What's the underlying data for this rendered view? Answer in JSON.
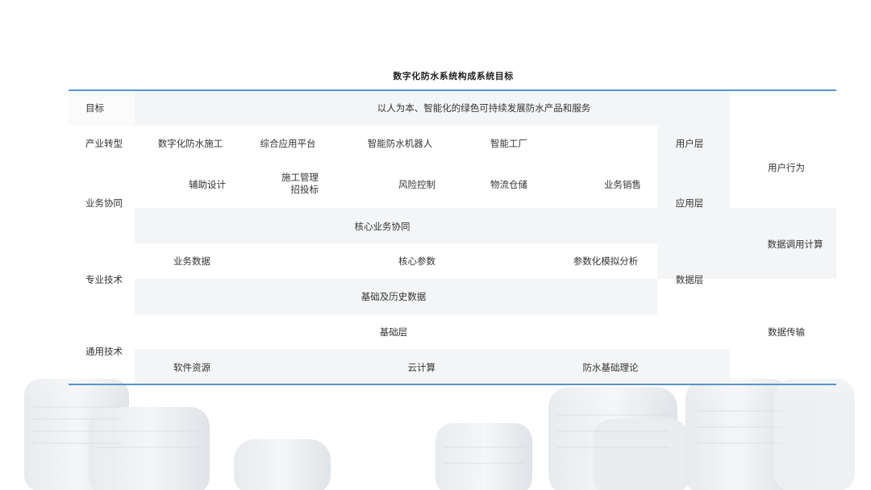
{
  "title": "数字化防水系统构成系统目标",
  "rows": {
    "goal": {
      "label": "目标",
      "text": "以人为本、智能化的绿色可持续发展防水产品和服务"
    },
    "transform": {
      "label": "产业转型",
      "items": [
        "数字化防水施工",
        "综合应用平台",
        "智能防水机器人",
        "智能工厂"
      ],
      "layer": "用户层"
    },
    "business": {
      "label": "业务协同",
      "items": [
        "辅助设计",
        "风险控制",
        "物流仓储",
        "业务销售"
      ],
      "stack": [
        "施工管理",
        "招投标"
      ],
      "core": "核心业务协同",
      "layer": "应用层"
    },
    "pro": {
      "label": "专业技术",
      "items": [
        "业务数据",
        "核心参数",
        "参数化模拟分析"
      ],
      "base": "基础及历史数据",
      "layer": "数据层"
    },
    "general": {
      "label": "通用技术",
      "base": "基础层",
      "items": [
        "软件资源",
        "云计算",
        "防水基础理论"
      ]
    }
  },
  "right": [
    "用户行为",
    "数据调用计算",
    "数据传输"
  ],
  "colors": {
    "rule": "#5b93c9",
    "band": "#f4f5f6"
  }
}
